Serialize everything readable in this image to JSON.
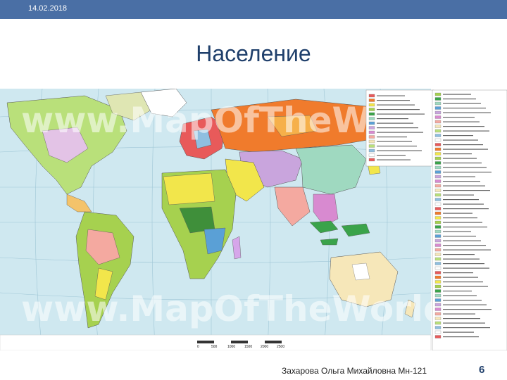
{
  "header": {
    "date": "14.02.2018"
  },
  "slide": {
    "title": "Население",
    "map": {
      "watermark": "www.MapOfTheWorld.n",
      "scale_ticks": [
        "0",
        "500",
        "1000",
        "1500",
        "2000",
        "2500"
      ],
      "colors": {
        "ocean": "#cfe8f0",
        "africa_green": "#a6d14f",
        "africa_yellow": "#f2e64b",
        "russia_orange": "#f07b2c",
        "europe_red": "#e85a5a",
        "china_mint": "#9fd9c0",
        "india_salmon": "#f4a9a0",
        "australia_cream": "#f6e7b9",
        "americas_lime": "#b9e07a",
        "indonesia_green": "#3aa34a"
      }
    }
  },
  "footer": {
    "author": "Захарова Ольга Михайловна Мн-121",
    "page": "6"
  }
}
